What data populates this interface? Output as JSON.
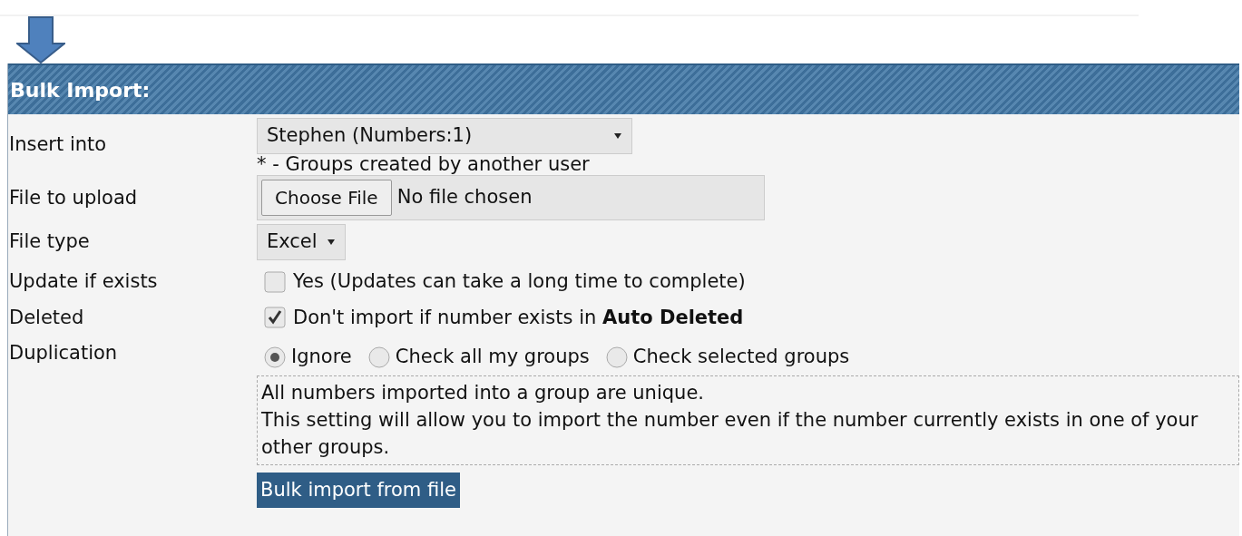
{
  "panel": {
    "heading": "Bulk Import:"
  },
  "fields": [
    {
      "kind": "select",
      "label": "Insert into",
      "value": "Stephen (Numbers:1)",
      "note": "* - Groups created by another user"
    },
    {
      "kind": "file",
      "label": "File to upload",
      "button": "Choose File",
      "status": "No file chosen"
    },
    {
      "kind": "select",
      "label": "File type",
      "value": "Excel"
    },
    {
      "kind": "checkbox",
      "label": "Update if exists",
      "checked": false,
      "text": "Yes (Updates can take a long time to complete)"
    },
    {
      "kind": "checkbox",
      "label": "Deleted",
      "checked": true,
      "text": "Don't import if number exists in **Auto Deleted**"
    },
    {
      "kind": "radio",
      "label": "Duplication",
      "options": [
        {
          "label": "Ignore",
          "selected": true
        },
        {
          "label": "Check all my groups",
          "selected": false
        },
        {
          "label": "Check selected groups",
          "selected": false
        }
      ],
      "help": [
        "All numbers imported into a group are unique.",
        "This setting will allow you to import the number even if the number currently exists in one of your other groups."
      ]
    }
  ],
  "submit": "Bulk import from file"
}
